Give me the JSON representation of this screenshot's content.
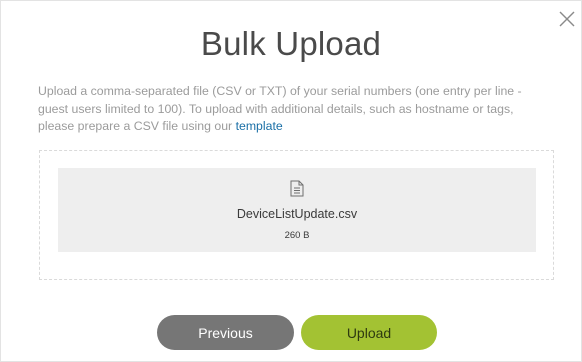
{
  "dialog": {
    "title": "Bulk Upload",
    "description": "Upload a comma-separated file (CSV or TXT) of your serial numbers (one entry per line - guest users limited to 100). To upload with additional details, such as hostname or tags, please prepare a CSV file using our ",
    "template_link": "template",
    "close_icon": "close-icon"
  },
  "file": {
    "icon": "document-icon",
    "name": "DeviceListUpdate.csv",
    "size": "260 B"
  },
  "buttons": {
    "previous_label": "Previous",
    "upload_label": "Upload"
  },
  "colors": {
    "previous_bg": "#767676",
    "upload_bg": "#a3c233",
    "link": "#1a6fa6"
  }
}
